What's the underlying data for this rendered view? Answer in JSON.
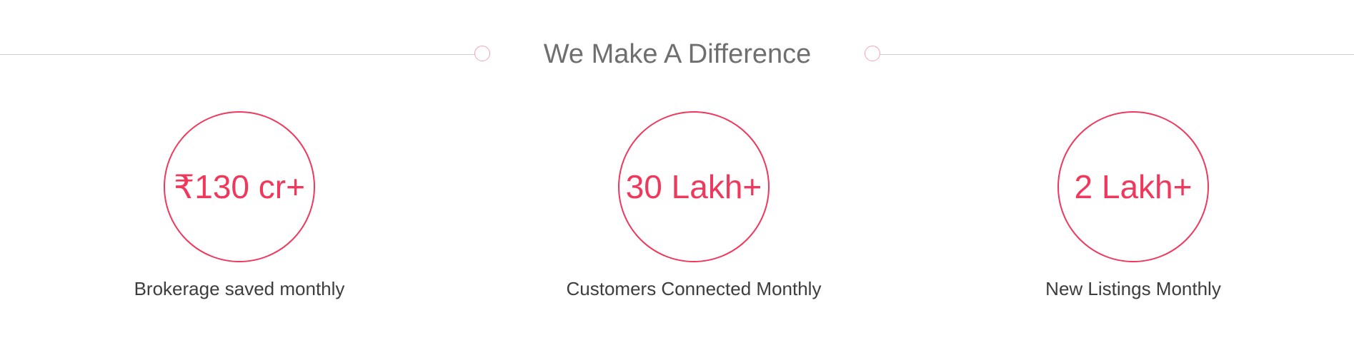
{
  "section": {
    "title": "We Make A Difference"
  },
  "stats": [
    {
      "value": "₹130 cr+",
      "label": "Brokerage saved monthly"
    },
    {
      "value": "30 Lakh+",
      "label": "Customers Connected Monthly"
    },
    {
      "value": "2 Lakh+",
      "label": "New Listings Monthly"
    }
  ],
  "colors": {
    "accent": "#f0385c",
    "title": "#6f6f6f",
    "label": "#3d3d3d",
    "divider": "#cfcfcf",
    "ring": "#f7a3b3"
  }
}
